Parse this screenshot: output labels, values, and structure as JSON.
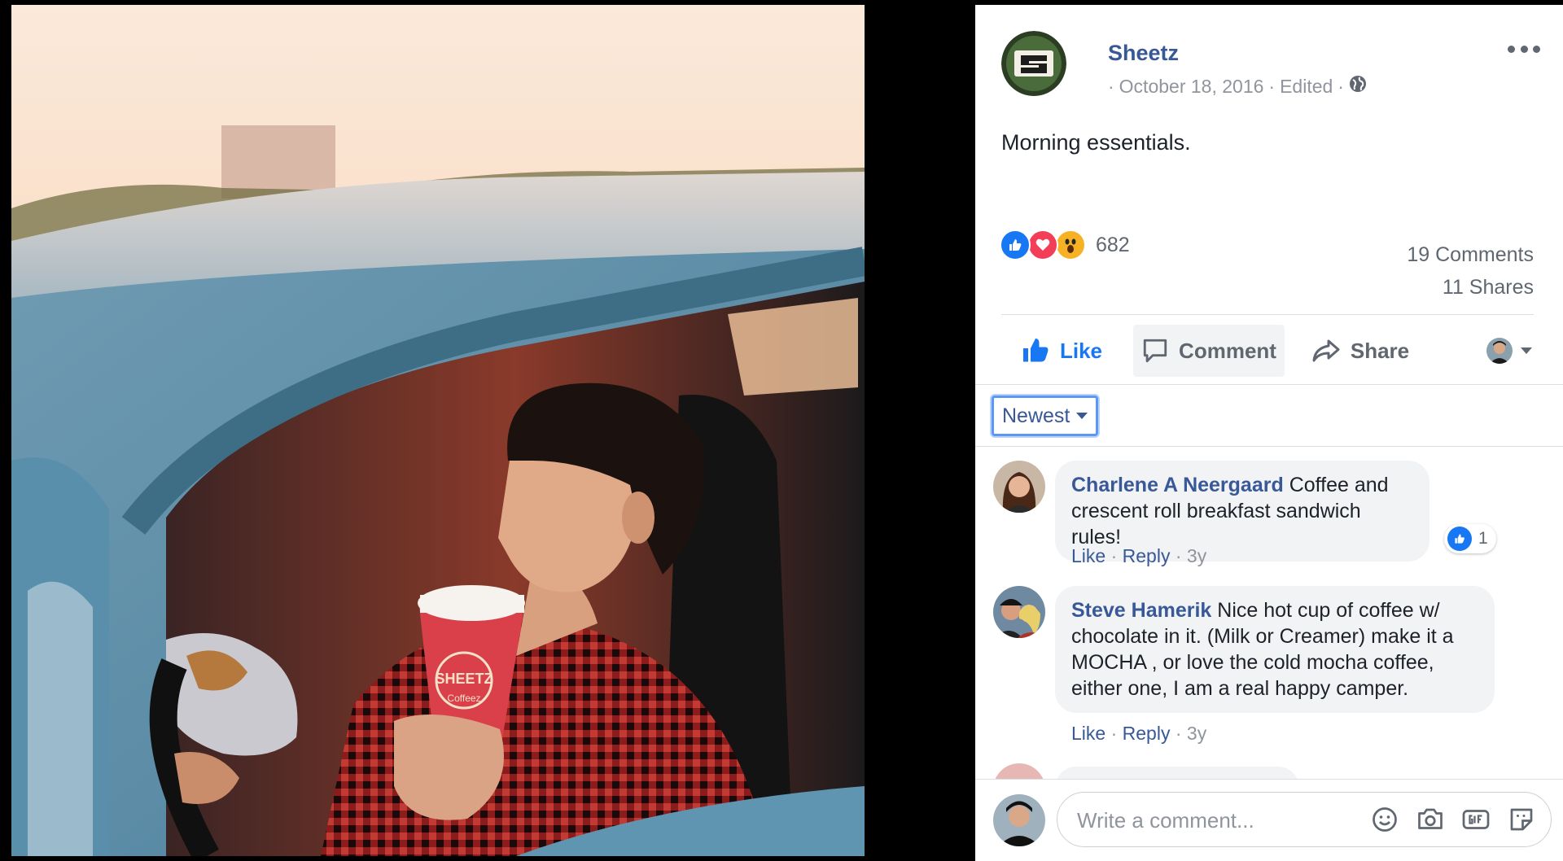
{
  "post": {
    "page_name": "Sheetz",
    "date": "October 18, 2016",
    "edited": "Edited",
    "text": "Morning essentials."
  },
  "reactions": {
    "types": [
      "like-icon",
      "love-icon",
      "wow-icon"
    ],
    "count": "682",
    "comments": "19 Comments",
    "shares": "11 Shares"
  },
  "actions": {
    "like": "Like",
    "comment": "Comment",
    "share": "Share"
  },
  "sort": {
    "label": "Newest"
  },
  "comments": [
    {
      "author": "Charlene A Neergaard",
      "text": "Coffee and crescent roll breakfast sandwich rules!",
      "like": "Like",
      "reply": "Reply",
      "age": "3y",
      "likes": "1"
    },
    {
      "author": "Steve Hamerik",
      "text": "Nice hot cup of coffee w/ chocolate in it. (Milk or Creamer) make it a MOCHA , or love the cold mocha coffee, either one, I am a real happy camper.",
      "like": "Like",
      "reply": "Reply",
      "age": "3y"
    }
  ],
  "composer": {
    "placeholder": "Write a comment..."
  },
  "photo": {
    "cup_text": "SHEETZ",
    "cup_sub": "Coffeez"
  },
  "colors": {
    "link": "#385898",
    "like_blue": "#1877f2",
    "love_red": "#f33e58",
    "wow_yellow": "#f7b125"
  }
}
